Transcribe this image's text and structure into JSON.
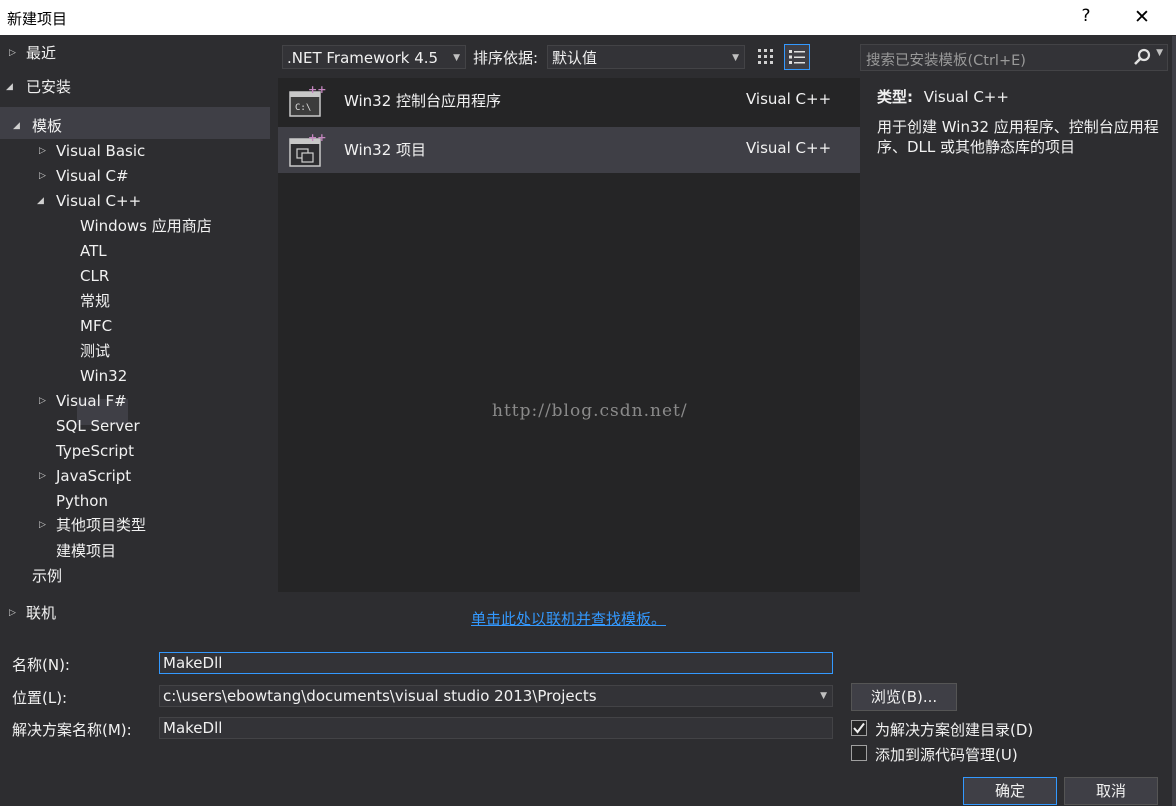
{
  "window": {
    "title": "新建项目",
    "help_label": "?",
    "close_label": "✕"
  },
  "tree": {
    "recent": "最近",
    "installed": "已安装",
    "templates": "模板",
    "visual_basic": "Visual Basic",
    "visual_csharp": "Visual C#",
    "visual_cpp": "Visual C++",
    "cpp_children": [
      "Windows 应用商店",
      "ATL",
      "CLR",
      "常规",
      "MFC",
      "测试",
      "Win32"
    ],
    "visual_fsharp": "Visual F#",
    "sql_server": "SQL Server",
    "typescript": "TypeScript",
    "javascript": "JavaScript",
    "python": "Python",
    "other_types": "其他项目类型",
    "modeling": "建模项目",
    "samples": "示例",
    "online": "联机"
  },
  "toolbar": {
    "framework": ".NET Framework 4.5",
    "sort_label": "排序依据:",
    "sort_value": "默认值",
    "search_placeholder": "搜索已安装模板(Ctrl+E)"
  },
  "templates": [
    {
      "name": "Win32 控制台应用程序",
      "lang": "Visual C++",
      "selected": false
    },
    {
      "name": "Win32 项目",
      "lang": "Visual C++",
      "selected": true
    }
  ],
  "watermark": "http://blog.csdn.net/",
  "online_link": "单击此处以联机并查找模板。",
  "description": {
    "type_key": "类型:",
    "type_value": "Visual C++",
    "text": "用于创建 Win32 应用程序、控制台应用程序、DLL 或其他静态库的项目"
  },
  "form": {
    "name_label": "名称(N):",
    "name_value": "MakeDll",
    "location_label": "位置(L):",
    "location_value": "c:\\users\\ebowtang\\documents\\visual studio 2013\\Projects",
    "solution_label": "解决方案名称(M):",
    "solution_value": "MakeDll",
    "browse": "浏览(B)...",
    "create_dir": "为解决方案创建目录(D)",
    "create_dir_checked": true,
    "add_source_control": "添加到源代码管理(U)",
    "add_source_control_checked": false,
    "ok": "确定",
    "cancel": "取消"
  },
  "colors": {
    "accent": "#3399ff",
    "background": "#2d2d30",
    "list_background": "#252526",
    "selection": "#3f3f46"
  }
}
